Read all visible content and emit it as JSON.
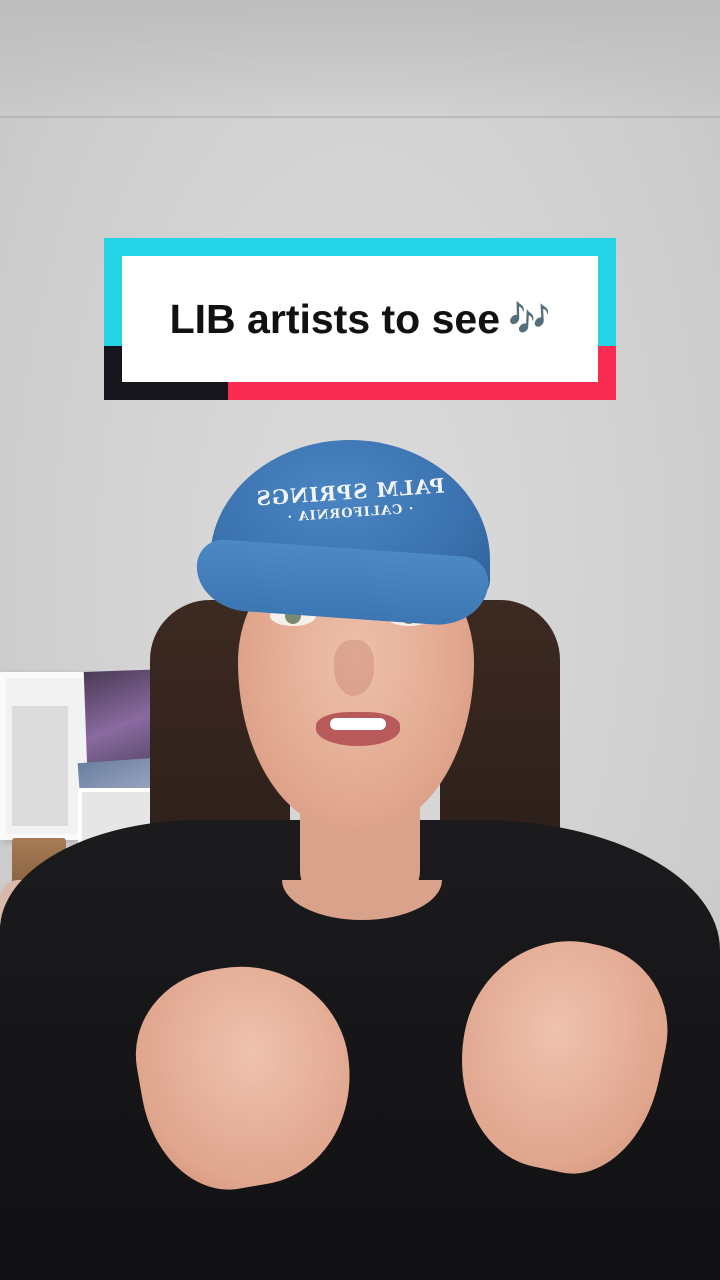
{
  "video": {
    "caption": "LIB artists to see",
    "caption_emoji": "🎶",
    "cap_text_line1": "PALM SPRINGS",
    "cap_text_line2": "· CALIFORNIA ·"
  },
  "colors": {
    "caption_cyan": "#25d3e6",
    "caption_red": "#fb2c52",
    "caption_dark": "#16161c",
    "cap_denim": "#3c74b1",
    "shirt": "#111113"
  }
}
